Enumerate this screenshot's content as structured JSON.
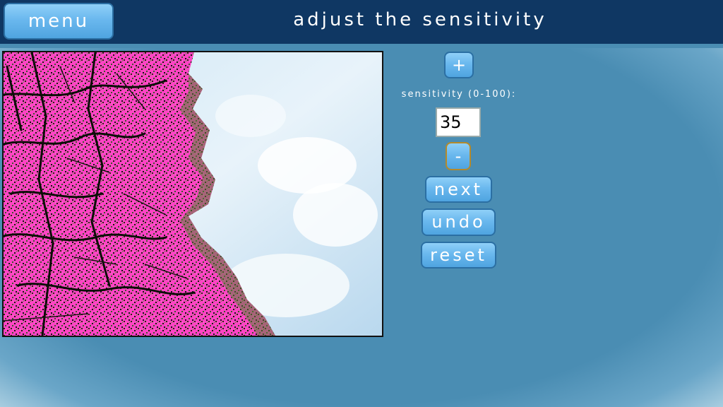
{
  "header": {
    "menu_label": "menu",
    "title": "adjust the sensitivity"
  },
  "controls": {
    "increase_label": "+",
    "sensitivity_label": "sensitivity (0-100):",
    "sensitivity_value": "35",
    "decrease_label": "-",
    "next_label": "next",
    "undo_label": "undo",
    "reset_label": "reset"
  },
  "colors": {
    "header_bg": "#0f3763",
    "panel_bg": "#4a8db3",
    "button_face": "#6ab8ee",
    "highlight_overlay": "#ff3fbf"
  },
  "photo": {
    "subject": "tree-canopy-with-sky",
    "highlight": "pink-selection-overlay"
  }
}
